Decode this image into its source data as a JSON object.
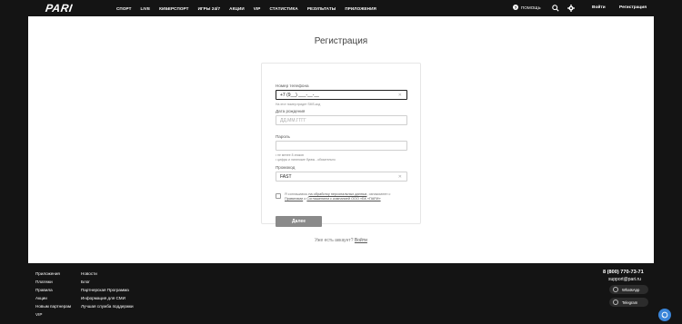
{
  "header": {
    "logo_text": "PARI",
    "nav": [
      "СПОРТ",
      "LIVE",
      "КИБЕРСПОРТ",
      "ИГРЫ 24/7",
      "АКЦИИ",
      "VIP",
      "СТАТИСТИКА",
      "РЕЗУЛЬТАТЫ",
      "ПРИЛОЖЕНИЯ"
    ],
    "help_label": "ПОМОЩЬ",
    "login_label": "Войти",
    "register_label": "Регистрация"
  },
  "registration": {
    "title": "Регистрация",
    "phone_label": "Номер телефона",
    "phone_value": "+7 (9__) ___-__-__",
    "phone_hint": "На этот номер придет SMS-код",
    "birth_label": "Дата рождения",
    "birth_placeholder": "ДД.ММ.ГГГГ",
    "password_label": "Пароль",
    "password_hint_1": "• не менее 8 знаков",
    "password_hint_2": "• цифры и латинские буквы - обязательно",
    "promo_label": "Промокод",
    "promo_value": "FAST",
    "consent_prefix": "Я соглашаюсь ",
    "consent_link1": "на обработку персональных данных",
    "consent_mid": ", ознакомлен с ",
    "consent_link2": "Правилами",
    "consent_and": " и ",
    "consent_link3": "Соглашением с компанией ООО «БК «ПАРИ»",
    "next_label": "Далее",
    "have_account": "Уже есть аккаунт?",
    "login_link": "Войти"
  },
  "footer": {
    "col1": [
      "Приложения",
      "Платежи",
      "Правила",
      "Акции",
      "Новым партнерам",
      "VIP"
    ],
    "col2": [
      "Новости",
      "Блог",
      "Партнерская Программа",
      "Информация для СМИ",
      "Лучшая служба поддержки"
    ],
    "phone": "8 (800) 770-73-71",
    "email": "support@pari.ru",
    "whatsapp": "WhatsApp",
    "telegram": "Telegram"
  }
}
